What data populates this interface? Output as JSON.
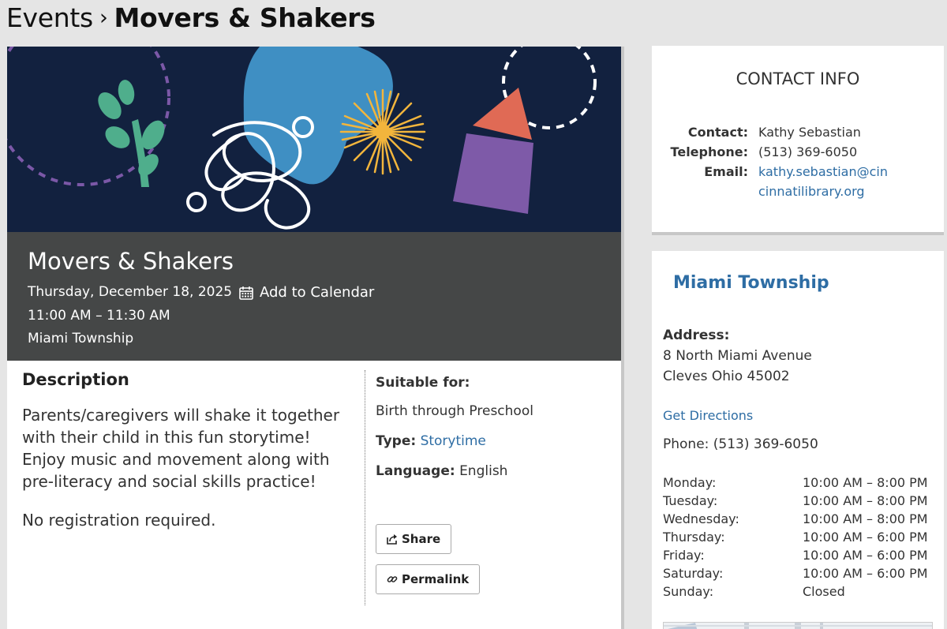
{
  "breadcrumb": {
    "parent": "Events",
    "separator": "›",
    "current": "Movers & Shakers"
  },
  "event": {
    "title": "Movers & Shakers",
    "date": "Thursday, December 18, 2025",
    "add_to_calendar": "Add to Calendar",
    "time": "11:00 AM – 11:30 AM",
    "location": "Miami Township"
  },
  "description": {
    "heading": "Description",
    "body": "Parents/caregivers will shake it together with their child in this fun storytime!  Enjoy music and movement along with pre-literacy and social skills practice!",
    "note": "No registration required."
  },
  "meta": {
    "suitable_label": "Suitable for:",
    "suitable_value": "Birth through Preschool",
    "type_label": "Type:",
    "type_value": "Storytime",
    "language_label": "Language:",
    "language_value": "English",
    "share_label": "Share",
    "permalink_label": "Permalink"
  },
  "contact": {
    "heading": "CONTACT INFO",
    "contact_label": "Contact:",
    "contact_value": "Kathy Sebastian",
    "telephone_label": "Telephone:",
    "telephone_value": "(513) 369-6050",
    "email_label": "Email:",
    "email_value": "kathy.sebastian@cincinnatilibrary.org"
  },
  "branch": {
    "name": "Miami Township",
    "address_label": "Address:",
    "address_line1": "8 North Miami Avenue",
    "address_line2": "Cleves Ohio 45002",
    "directions": "Get Directions",
    "phone": "Phone: (513) 369-6050",
    "hours": [
      {
        "day": "Monday:",
        "time": "10:00 AM – 8:00 PM"
      },
      {
        "day": "Tuesday:",
        "time": "10:00 AM – 8:00 PM"
      },
      {
        "day": "Wednesday:",
        "time": "10:00 AM – 8:00 PM"
      },
      {
        "day": "Thursday:",
        "time": "10:00 AM – 6:00 PM"
      },
      {
        "day": "Friday:",
        "time": "10:00 AM – 6:00 PM"
      },
      {
        "day": "Saturday:",
        "time": "10:00 AM – 6:00 PM"
      },
      {
        "day": "Sunday:",
        "time": "Closed"
      }
    ]
  },
  "colors": {
    "page_bg": "#e5e5e5",
    "hero_bg": "#12213f",
    "event_header_bg": "#454747",
    "link": "#2e6da4",
    "leaf": "#4fae8c",
    "blob": "#3f8fc3",
    "sun": "#f2b53c",
    "crayon_tip": "#e06a55",
    "crayon_body": "#7e5aa8",
    "dashed_circle": "#7b58a7"
  },
  "icons": {
    "calendar": "calendar-icon",
    "share": "share-icon",
    "permalink": "link-icon"
  }
}
